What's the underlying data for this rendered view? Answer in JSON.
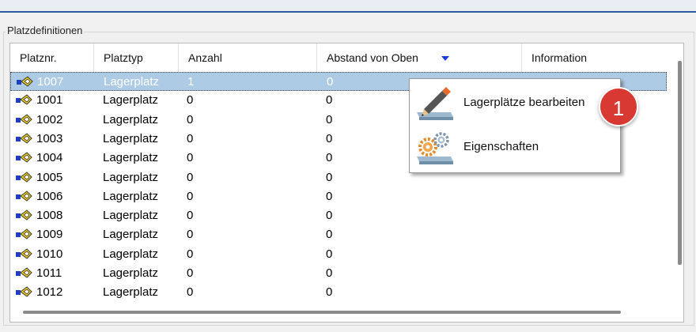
{
  "group": {
    "title": "Platzdefinitionen"
  },
  "columns": [
    "Platznr.",
    "Platztyp",
    "Anzahl",
    "Abstand von Oben",
    "Information"
  ],
  "sort": {
    "column": "Abstand von Oben",
    "direction": "desc"
  },
  "rows": [
    {
      "nr": "1007",
      "typ": "Lagerplatz",
      "anzahl": "1",
      "abstand": "0",
      "selected": true
    },
    {
      "nr": "1001",
      "typ": "Lagerplatz",
      "anzahl": "0",
      "abstand": "0"
    },
    {
      "nr": "1002",
      "typ": "Lagerplatz",
      "anzahl": "0",
      "abstand": "0"
    },
    {
      "nr": "1003",
      "typ": "Lagerplatz",
      "anzahl": "0",
      "abstand": "0"
    },
    {
      "nr": "1004",
      "typ": "Lagerplatz",
      "anzahl": "0",
      "abstand": "0"
    },
    {
      "nr": "1005",
      "typ": "Lagerplatz",
      "anzahl": "0",
      "abstand": "0"
    },
    {
      "nr": "1006",
      "typ": "Lagerplatz",
      "anzahl": "0",
      "abstand": "0"
    },
    {
      "nr": "1008",
      "typ": "Lagerplatz",
      "anzahl": "0",
      "abstand": "0"
    },
    {
      "nr": "1009",
      "typ": "Lagerplatz",
      "anzahl": "0",
      "abstand": "0"
    },
    {
      "nr": "1010",
      "typ": "Lagerplatz",
      "anzahl": "0",
      "abstand": "0"
    },
    {
      "nr": "1011",
      "typ": "Lagerplatz",
      "anzahl": "0",
      "abstand": "0"
    },
    {
      "nr": "1012",
      "typ": "Lagerplatz",
      "anzahl": "0",
      "abstand": "0"
    }
  ],
  "context_menu": {
    "items": [
      {
        "label": "Lagerplätze bearbeiten",
        "icon": "pencil-edit-icon"
      },
      {
        "label": "Eigenschaften",
        "icon": "gears-properties-icon"
      }
    ]
  },
  "annotation": {
    "label": "1",
    "color": "#d83a33"
  },
  "colors": {
    "selection": "#aecbe6",
    "sort_arrow": "#1a3fd6",
    "title_bar_line": "#2d5a9e"
  },
  "icons": {
    "row": "storage-place-icon",
    "sort": "sort-descending-icon"
  }
}
